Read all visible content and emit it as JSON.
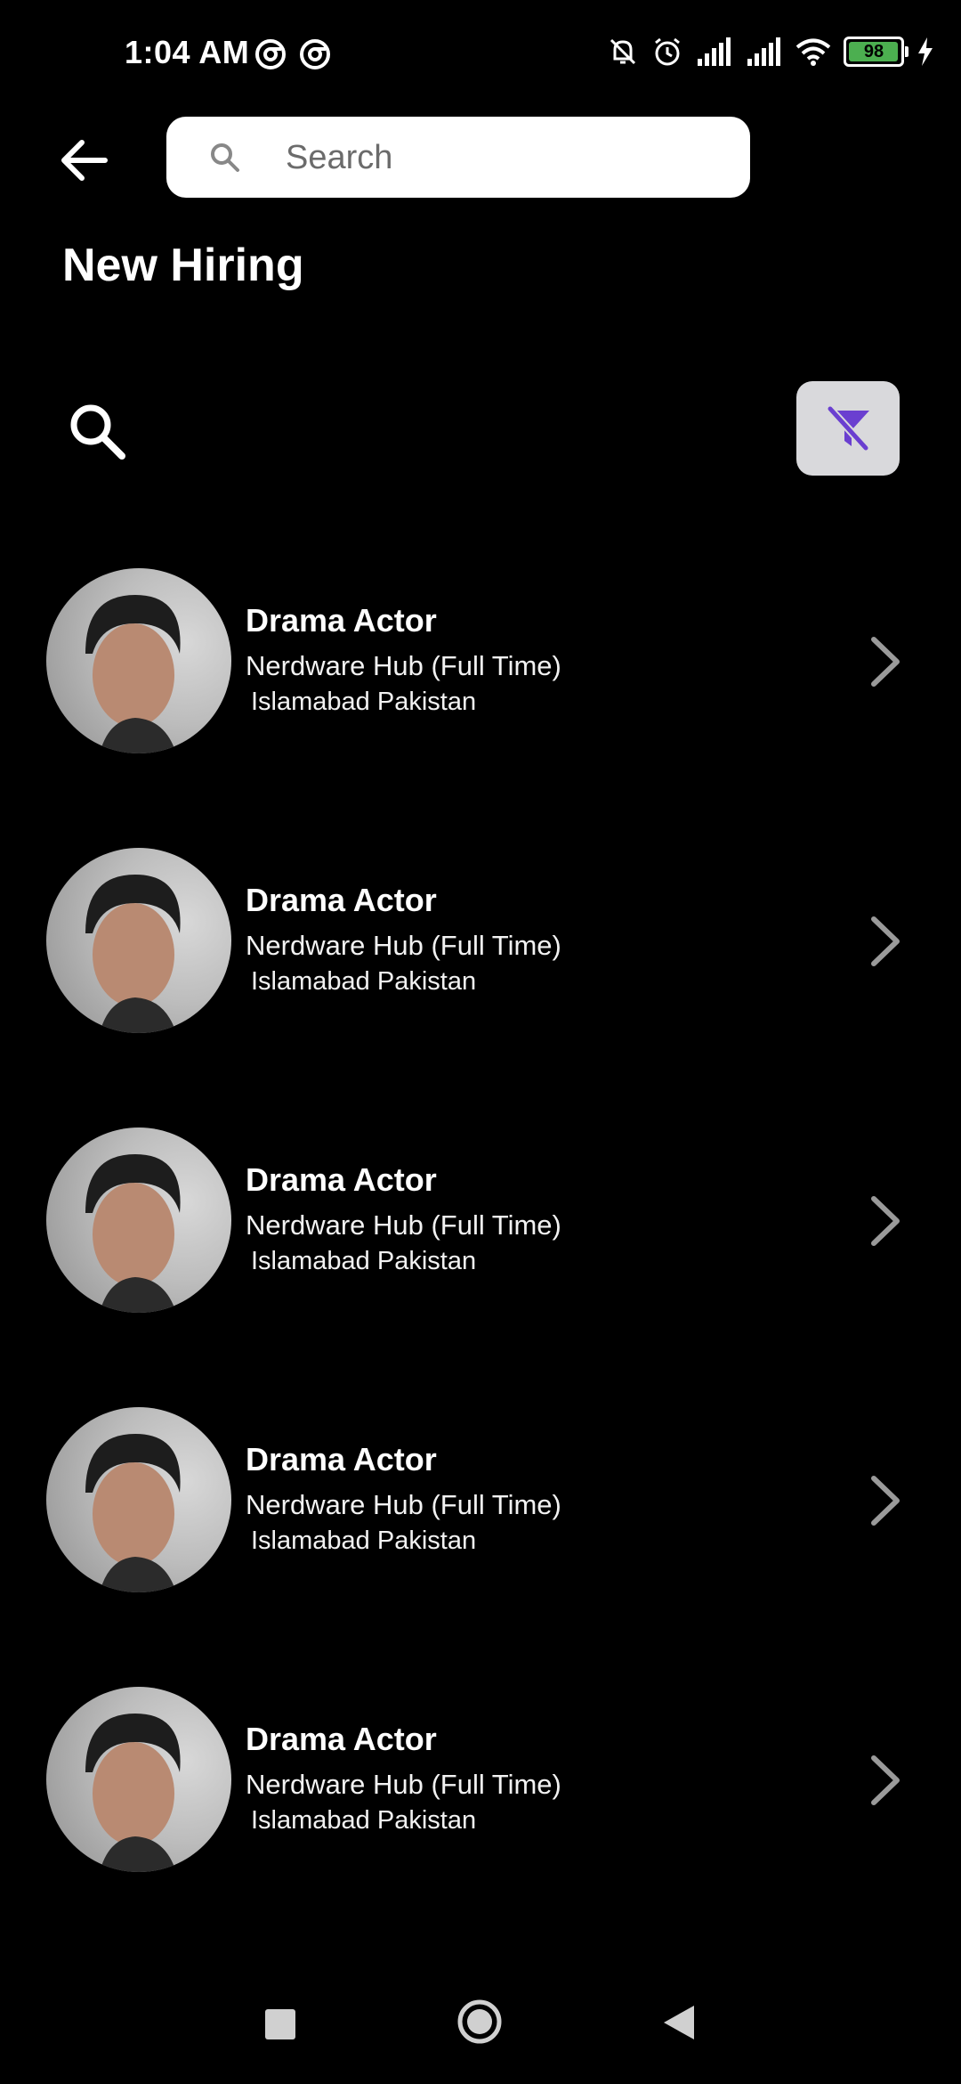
{
  "status_bar": {
    "time": "1:04 AM",
    "battery": "98",
    "battery_level": 0.98,
    "left_icons": [
      "sync-icon",
      "sync-icon"
    ],
    "right_icons": [
      "mute-icon",
      "alarm-icon",
      "signal-icon",
      "signal-icon",
      "wifi-icon",
      "battery-icon",
      "charging-icon"
    ]
  },
  "header": {
    "back_icon": "arrow-left-icon",
    "search_placeholder": "Search",
    "title": "New Hiring"
  },
  "toolbar": {
    "search_icon": "search-icon",
    "filter_icon": "filter-off-icon",
    "filter_color": "#6a3fd0"
  },
  "jobs": [
    {
      "title": "Drama Actor",
      "company": "Nerdware Hub (Full Time)",
      "location": "Islamabad Pakistan"
    },
    {
      "title": "Drama Actor",
      "company": "Nerdware Hub (Full Time)",
      "location": "Islamabad Pakistan"
    },
    {
      "title": "Drama Actor",
      "company": "Nerdware Hub (Full Time)",
      "location": "Islamabad Pakistan"
    },
    {
      "title": "Drama Actor",
      "company": "Nerdware Hub (Full Time)",
      "location": "Islamabad Pakistan"
    },
    {
      "title": "Drama Actor",
      "company": "Nerdware Hub (Full Time)",
      "location": "Islamabad Pakistan"
    }
  ],
  "nav_bar": {
    "items": [
      "recent-apps-button",
      "home-button",
      "back-button"
    ]
  }
}
